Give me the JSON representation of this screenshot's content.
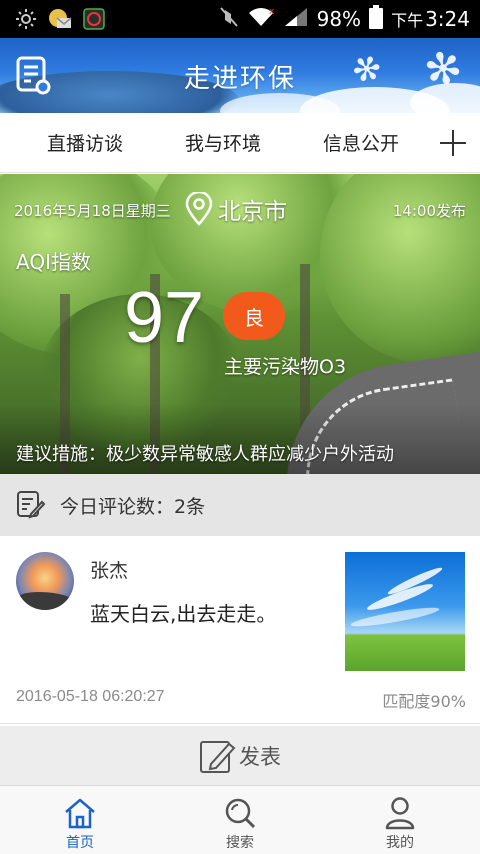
{
  "status_bar": {
    "battery": "98%",
    "time_prefix": "下午",
    "time": "3:24",
    "icons": [
      "brightness-icon",
      "mail-app-icon",
      "clean-app-icon",
      "mute-icon",
      "wifi-icon",
      "signal-icon",
      "battery-icon"
    ]
  },
  "header": {
    "title": "走进环保",
    "menu_icon": "document-list-icon"
  },
  "tabs": [
    {
      "label": "直播访谈"
    },
    {
      "label": "我与环境"
    },
    {
      "label": "信息公开"
    }
  ],
  "tabs_add_icon": "plus-icon",
  "hero": {
    "date": "2016年5月18日星期三",
    "city": "北京市",
    "publish_time": "14:00发布",
    "aqi_label": "AQI指数",
    "aqi_value": "97",
    "level": "良",
    "level_color": "#f25a1b",
    "pollutant": "主要污染物O3",
    "advice": "建议措施：极少数异常敏感人群应减少户外活动"
  },
  "comments_bar": {
    "text": "今日评论数：2条"
  },
  "comment": {
    "user": "张杰",
    "text": "蓝天白云,出去走走。",
    "time": "2016-05-18 06:20:27",
    "match": "匹配度90%"
  },
  "publish": {
    "label": "发表"
  },
  "bottom_nav": [
    {
      "label": "首页",
      "icon": "home-icon",
      "active": true
    },
    {
      "label": "搜索",
      "icon": "search-icon",
      "active": false
    },
    {
      "label": "我的",
      "icon": "person-icon",
      "active": false
    }
  ],
  "colors": {
    "accent": "#1c63c6",
    "header_blue": "#2f7be0",
    "badge_orange": "#f25a1b"
  }
}
